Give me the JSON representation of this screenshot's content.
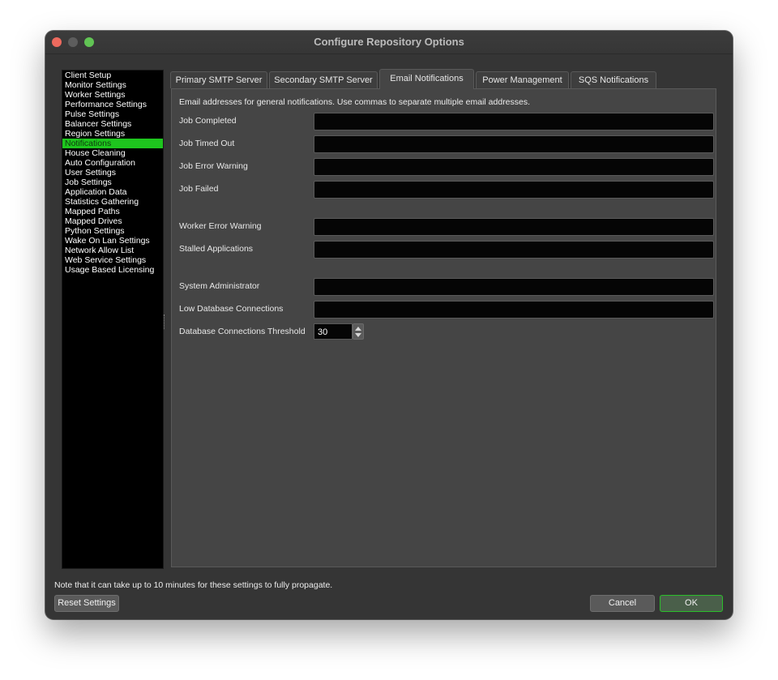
{
  "window": {
    "title": "Configure Repository Options"
  },
  "sidebar": {
    "items": [
      {
        "label": "Client Setup",
        "active": false
      },
      {
        "label": "Monitor Settings",
        "active": false
      },
      {
        "label": "Worker Settings",
        "active": false
      },
      {
        "label": "Performance Settings",
        "active": false
      },
      {
        "label": "Pulse Settings",
        "active": false
      },
      {
        "label": "Balancer Settings",
        "active": false
      },
      {
        "label": "Region Settings",
        "active": false
      },
      {
        "label": "Notifications",
        "active": true
      },
      {
        "label": "House Cleaning",
        "active": false
      },
      {
        "label": "Auto Configuration",
        "active": false
      },
      {
        "label": "User Settings",
        "active": false
      },
      {
        "label": "Job Settings",
        "active": false
      },
      {
        "label": "Application Data",
        "active": false
      },
      {
        "label": "Statistics Gathering",
        "active": false
      },
      {
        "label": "Mapped Paths",
        "active": false
      },
      {
        "label": "Mapped Drives",
        "active": false
      },
      {
        "label": "Python Settings",
        "active": false
      },
      {
        "label": "Wake On Lan Settings",
        "active": false
      },
      {
        "label": "Network Allow List",
        "active": false
      },
      {
        "label": "Web Service Settings",
        "active": false
      },
      {
        "label": "Usage Based Licensing",
        "active": false
      }
    ]
  },
  "tabs": [
    {
      "label": "Primary SMTP Server",
      "active": false
    },
    {
      "label": "Secondary SMTP Server",
      "active": false
    },
    {
      "label": "Email Notifications",
      "active": true
    },
    {
      "label": "Power Management",
      "active": false
    },
    {
      "label": "SQS Notifications",
      "active": false
    }
  ],
  "panel": {
    "intro": "Email addresses for general notifications. Use commas to separate multiple email addresses.",
    "fields": {
      "job_completed": {
        "label": "Job Completed",
        "value": ""
      },
      "job_timed_out": {
        "label": "Job Timed Out",
        "value": ""
      },
      "job_error_warning": {
        "label": "Job Error Warning",
        "value": ""
      },
      "job_failed": {
        "label": "Job Failed",
        "value": ""
      },
      "worker_error_warning": {
        "label": "Worker Error Warning",
        "value": ""
      },
      "stalled_applications": {
        "label": "Stalled Applications",
        "value": ""
      },
      "system_administrator": {
        "label": "System Administrator",
        "value": ""
      },
      "low_database_connections": {
        "label": "Low Database Connections",
        "value": ""
      }
    },
    "threshold": {
      "label": "Database Connections Threshold",
      "value": "30"
    }
  },
  "footer": {
    "note": "Note that it can take up to 10 minutes for these settings to fully propagate.",
    "reset_label": "Reset Settings",
    "cancel_label": "Cancel",
    "ok_label": "OK"
  },
  "colors": {
    "accent": "#1ec51e",
    "window_bg": "#353535",
    "panel_bg": "#454545",
    "input_bg": "#050505"
  }
}
